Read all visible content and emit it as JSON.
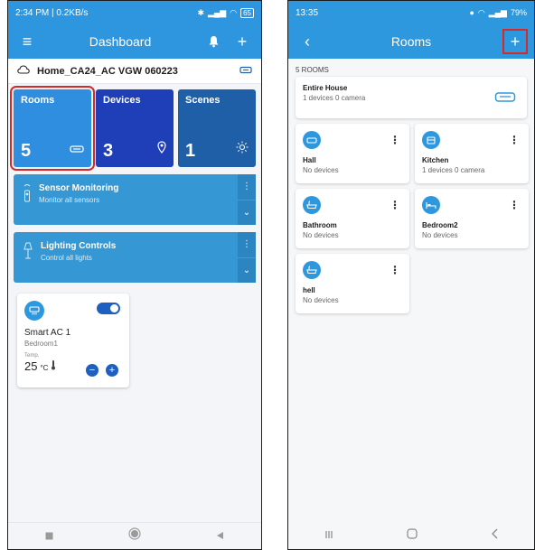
{
  "left": {
    "status": {
      "time": "2:34 PM | 0.2KB/s",
      "battery": "65"
    },
    "appbar": {
      "title": "Dashboard"
    },
    "home": {
      "name": "Home_CA24_AC VGW 060223"
    },
    "tiles": [
      {
        "label": "Rooms",
        "count": "5"
      },
      {
        "label": "Devices",
        "count": "3"
      },
      {
        "label": "Scenes",
        "count": "1"
      }
    ],
    "controls": [
      {
        "title": "Sensor Monitoring",
        "subtitle": "Monitor all sensors"
      },
      {
        "title": "Lighting Controls",
        "subtitle": "Control all lights"
      }
    ],
    "device": {
      "name": "Smart AC 1",
      "room": "Bedroom1",
      "temp_label": "Temp.",
      "temp_value": "25",
      "temp_unit": "°C",
      "minus": "−",
      "plus": "+"
    }
  },
  "right": {
    "status": {
      "time": "13:35",
      "battery": "79%"
    },
    "appbar": {
      "title": "Rooms"
    },
    "rooms_count": "5 ROOMS",
    "entire_house": {
      "name": "Entire House",
      "subtitle": "1 devices 0 camera"
    },
    "rooms": [
      {
        "name": "Hall",
        "subtitle": "No devices"
      },
      {
        "name": "Kitchen",
        "subtitle": "1 devices 0 camera"
      },
      {
        "name": "Bathroom",
        "subtitle": "No devices"
      },
      {
        "name": "Bedroom2",
        "subtitle": "No devices"
      },
      {
        "name": "hell",
        "subtitle": "No devices"
      }
    ]
  },
  "colors": {
    "primary": "#2e98df",
    "rooms_tile": "#2f8ee0",
    "devices_tile": "#1f3fb8",
    "scenes_tile": "#1f5fa8",
    "highlight": "#d42a2a"
  }
}
